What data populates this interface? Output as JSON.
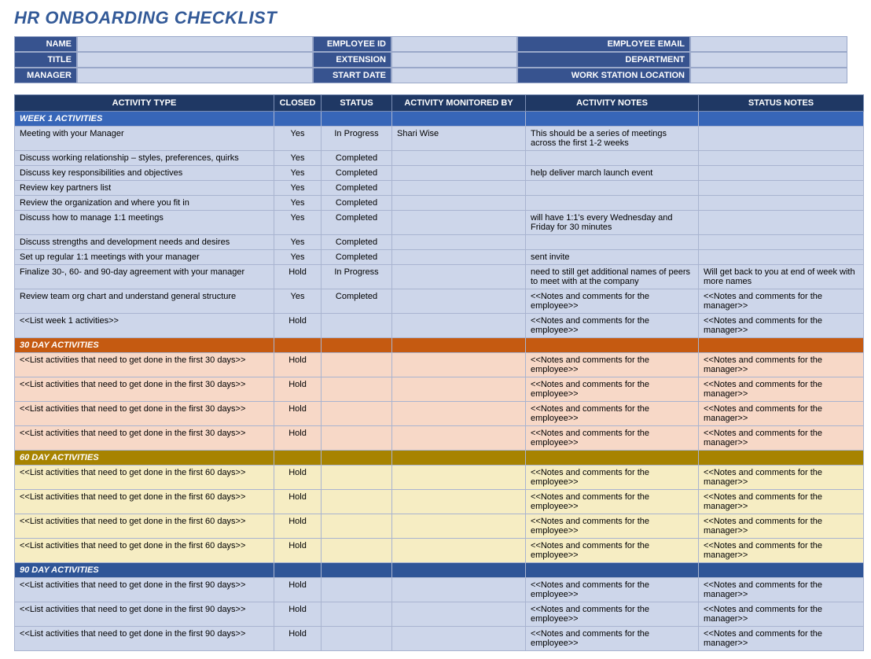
{
  "title": "HR ONBOARDING CHECKLIST",
  "header": {
    "row1": {
      "l1": "NAME",
      "v1": "",
      "l2": "EMPLOYEE ID",
      "v2": "",
      "l3": "EMPLOYEE EMAIL",
      "v3": ""
    },
    "row2": {
      "l1": "TITLE",
      "v1": "",
      "l2": "EXTENSION",
      "v2": "",
      "l3": "DEPARTMENT",
      "v3": ""
    },
    "row3": {
      "l1": "MANAGER",
      "v1": "",
      "l2": "START DATE",
      "v2": "",
      "l3": "WORK STATION LOCATION",
      "v3": ""
    }
  },
  "columns": [
    "ACTIVITY TYPE",
    "CLOSED",
    "STATUS",
    "ACTIVITY MONITORED BY",
    "ACTIVITY NOTES",
    "STATUS NOTES"
  ],
  "sections": [
    {
      "label": "WEEK 1 ACTIVITIES",
      "class": "week1",
      "rowClass": "week1-row",
      "rows": [
        {
          "activity": "Meeting with your Manager",
          "closed": "Yes",
          "status": "In Progress",
          "monitor": "Shari Wise",
          "anotes": "This should be a series of meetings across the first 1-2 weeks",
          "snotes": ""
        },
        {
          "activity": "Discuss working relationship – styles, preferences, quirks",
          "closed": "Yes",
          "status": "Completed",
          "monitor": "",
          "anotes": "",
          "snotes": ""
        },
        {
          "activity": "Discuss key responsibilities and objectives",
          "closed": "Yes",
          "status": "Completed",
          "monitor": "",
          "anotes": "help deliver march launch event",
          "snotes": ""
        },
        {
          "activity": "Review key partners list",
          "closed": "Yes",
          "status": "Completed",
          "monitor": "",
          "anotes": "",
          "snotes": ""
        },
        {
          "activity": "Review the organization and where you fit in",
          "closed": "Yes",
          "status": "Completed",
          "monitor": "",
          "anotes": "",
          "snotes": ""
        },
        {
          "activity": "Discuss how to manage 1:1 meetings",
          "closed": "Yes",
          "status": "Completed",
          "monitor": "",
          "anotes": "will have 1:1's every Wednesday and Friday for 30 minutes",
          "snotes": ""
        },
        {
          "activity": "Discuss strengths and development needs and desires",
          "closed": "Yes",
          "status": "Completed",
          "monitor": "",
          "anotes": "",
          "snotes": ""
        },
        {
          "activity": "Set up regular 1:1 meetings with your manager",
          "closed": "Yes",
          "status": "Completed",
          "monitor": "",
          "anotes": "sent invite",
          "snotes": ""
        },
        {
          "activity": "Finalize 30-, 60- and 90-day agreement with your manager",
          "closed": "Hold",
          "status": "In Progress",
          "monitor": "",
          "anotes": "need to still get additional names of peers to meet with at the company",
          "snotes": "Will get back to you at end of week with more names"
        },
        {
          "activity": "Review team org chart and understand general structure",
          "closed": "Yes",
          "status": "Completed",
          "monitor": "",
          "anotes": "<<Notes and comments for the employee>>",
          "snotes": "<<Notes and comments for the manager>>"
        },
        {
          "activity": "<<List week 1 activities>>",
          "closed": "Hold",
          "status": "",
          "monitor": "",
          "anotes": "<<Notes and comments for the employee>>",
          "snotes": "<<Notes and comments for the manager>>"
        }
      ]
    },
    {
      "label": "30 DAY ACTIVITIES",
      "class": "thirty",
      "rowClass": "thirty-row",
      "rows": [
        {
          "activity": "<<List activities that need to get done in the first 30 days>>",
          "closed": "Hold",
          "status": "",
          "monitor": "",
          "anotes": "<<Notes and comments for the employee>>",
          "snotes": "<<Notes and comments for the manager>>"
        },
        {
          "activity": "<<List activities that need to get done in the first 30 days>>",
          "closed": "Hold",
          "status": "",
          "monitor": "",
          "anotes": "<<Notes and comments for the employee>>",
          "snotes": "<<Notes and comments for the manager>>"
        },
        {
          "activity": "<<List activities that need to get done in the first 30 days>>",
          "closed": "Hold",
          "status": "",
          "monitor": "",
          "anotes": "<<Notes and comments for the employee>>",
          "snotes": "<<Notes and comments for the manager>>"
        },
        {
          "activity": "<<List activities that need to get done in the first 30 days>>",
          "closed": "Hold",
          "status": "",
          "monitor": "",
          "anotes": "<<Notes and comments for the employee>>",
          "snotes": "<<Notes and comments for the manager>>"
        }
      ]
    },
    {
      "label": "60 DAY ACTIVITIES",
      "class": "sixty",
      "rowClass": "sixty-row",
      "rows": [
        {
          "activity": "<<List activities that need to get done in the first 60 days>>",
          "closed": "Hold",
          "status": "",
          "monitor": "",
          "anotes": "<<Notes and comments for the employee>>",
          "snotes": "<<Notes and comments for the manager>>"
        },
        {
          "activity": "<<List activities that need to get done in the first 60 days>>",
          "closed": "Hold",
          "status": "",
          "monitor": "",
          "anotes": "<<Notes and comments for the employee>>",
          "snotes": "<<Notes and comments for the manager>>"
        },
        {
          "activity": "<<List activities that need to get done in the first 60 days>>",
          "closed": "Hold",
          "status": "",
          "monitor": "",
          "anotes": "<<Notes and comments for the employee>>",
          "snotes": "<<Notes and comments for the manager>>"
        },
        {
          "activity": "<<List activities that need to get done in the first 60 days>>",
          "closed": "Hold",
          "status": "",
          "monitor": "",
          "anotes": "<<Notes and comments for the employee>>",
          "snotes": "<<Notes and comments for the manager>>"
        }
      ]
    },
    {
      "label": "90 DAY ACTIVITIES",
      "class": "ninety",
      "rowClass": "ninety-row",
      "rows": [
        {
          "activity": "<<List activities that need to get done in the first 90 days>>",
          "closed": "Hold",
          "status": "",
          "monitor": "",
          "anotes": "<<Notes and comments for the employee>>",
          "snotes": "<<Notes and comments for the manager>>"
        },
        {
          "activity": "<<List activities that need to get done in the first 90 days>>",
          "closed": "Hold",
          "status": "",
          "monitor": "",
          "anotes": "<<Notes and comments for the employee>>",
          "snotes": "<<Notes and comments for the manager>>"
        },
        {
          "activity": "<<List activities that need to get done in the first 90 days>>",
          "closed": "Hold",
          "status": "",
          "monitor": "",
          "anotes": "<<Notes and comments for the employee>>",
          "snotes": "<<Notes and comments for the manager>>"
        }
      ]
    }
  ]
}
